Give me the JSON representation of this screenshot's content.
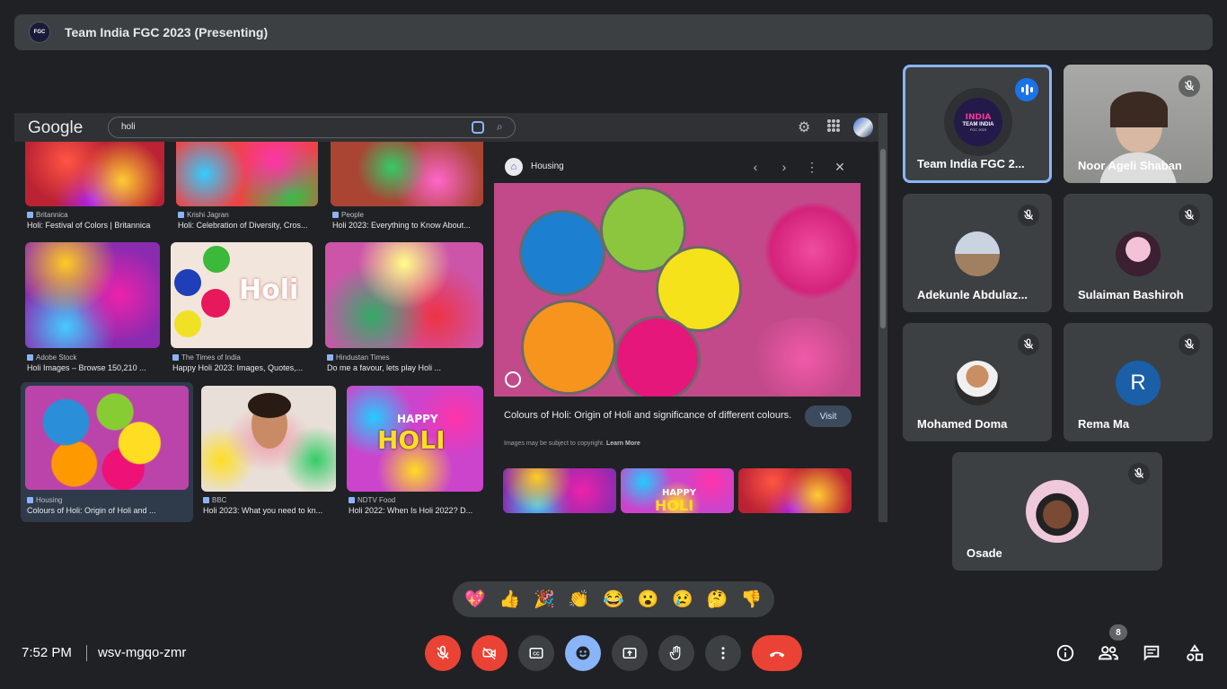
{
  "meeting": {
    "title": "Team India FGC 2023 (Presenting)",
    "logo_label": "Team India FGC 2023",
    "time": "7:52 PM",
    "code": "wsv-mgqo-zmr",
    "people_count": "8"
  },
  "shared_screen": {
    "google_logo": "Google",
    "search_query": "holi",
    "results": [
      {
        "source": "Britannica",
        "title": "Holi: Festival of Colors | Britannica"
      },
      {
        "source": "Krishi Jagran",
        "title": "Holi: Celebration of Diversity, Cros..."
      },
      {
        "source": "People",
        "title": "Holi 2023: Everything to Know About..."
      },
      {
        "source": "Adobe Stock",
        "title": "Holi Images – Browse 150,210 ..."
      },
      {
        "source": "The Times of India",
        "title": "Happy Holi 2023: Images, Quotes,..."
      },
      {
        "source": "Hindustan Times",
        "title": "Do me a favour, lets play Holi ..."
      },
      {
        "source": "Housing",
        "title": "Colours of Holi: Origin of Holi and ..."
      },
      {
        "source": "BBC",
        "title": "Holi 2023: What you need to kn..."
      },
      {
        "source": "NDTV Food",
        "title": "Holi 2022: When Is Holi 2022? D..."
      }
    ],
    "image_texts": {
      "holi_script": "Holi",
      "happy": "HAPPY",
      "holi_caps": "HOLI"
    },
    "preview": {
      "site": "Housing",
      "title": "Colours of Holi: Origin of Holi and significance of different colours.",
      "visit_label": "Visit",
      "note": "Images may be subject to copyright.",
      "learn_more": "Learn More",
      "thumb_happy": "HAPPY",
      "thumb_holi": "HOLI"
    }
  },
  "participants": [
    {
      "name": "Team India FGC 2...",
      "state": "speaking"
    },
    {
      "name": "Noor Ageli Shaban",
      "state": "muted"
    },
    {
      "name": "Adekunle Abdulaz...",
      "state": "muted"
    },
    {
      "name": "Sulaiman Bashiroh",
      "state": "muted"
    },
    {
      "name": "Mohamed Doma",
      "state": "muted"
    },
    {
      "name": "Rema Ma",
      "state": "muted",
      "initial": "R"
    },
    {
      "name": "Osade",
      "state": "muted"
    }
  ],
  "team_avatar_text": {
    "top": "INDIA",
    "mid": "TEAM INDIA",
    "bottom": "FGC 2023"
  },
  "reactions": [
    "💖",
    "👍",
    "🎉",
    "👏",
    "😂",
    "😮",
    "😢",
    "🤔",
    "👎"
  ],
  "colors": {
    "background": "#202124",
    "surface": "#3c4043",
    "danger": "#ea4335",
    "accent": "#8ab4f8",
    "speaking": "#1a73e8"
  }
}
